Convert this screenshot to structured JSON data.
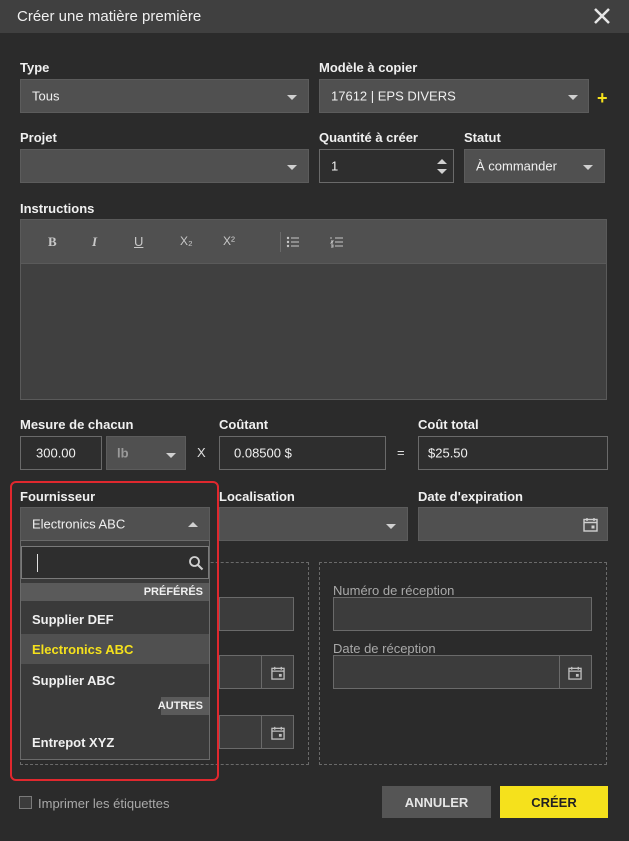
{
  "dialog": {
    "title": "Créer une matière première"
  },
  "type": {
    "label": "Type",
    "value": "Tous"
  },
  "model": {
    "label": "Modèle à copier",
    "value": "17612 | EPS DIVERS",
    "add_icon": "plus-icon"
  },
  "project": {
    "label": "Projet",
    "value": ""
  },
  "quantity": {
    "label": "Quantité à créer",
    "value": "1"
  },
  "status": {
    "label": "Statut",
    "value": "À commander"
  },
  "instructions": {
    "label": "Instructions",
    "toolbar": {
      "bold": "B",
      "italic": "I",
      "underline": "U",
      "subscript": "X₂",
      "superscript": "X²"
    }
  },
  "measure": {
    "label": "Mesure de chacun",
    "value": "300.00",
    "unit": "lb"
  },
  "times_symbol": "X",
  "cost": {
    "label": "Coûtant",
    "value": "0.08500 $"
  },
  "equals_symbol": "=",
  "total": {
    "label": "Coût total",
    "value": "$25.50"
  },
  "supplier": {
    "label": "Fournisseur",
    "value": "Electronics ABC",
    "search_value": "",
    "groups": [
      {
        "name": "PRÉFÉRÉS",
        "items": [
          "Supplier DEF",
          "Electronics ABC",
          "Supplier ABC"
        ]
      },
      {
        "name": "AUTRES",
        "items": [
          "Entrepot XYZ"
        ]
      }
    ],
    "selected": "Electronics ABC"
  },
  "location": {
    "label": "Localisation",
    "value": ""
  },
  "expiration": {
    "label": "Date d'expiration",
    "value": ""
  },
  "reception": {
    "number_label": "Numéro de réception",
    "number_value": "",
    "date_label": "Date de réception",
    "date_value": ""
  },
  "print_labels": {
    "label": "Imprimer les étiquettes",
    "checked": false
  },
  "buttons": {
    "cancel": "ANNULER",
    "create": "CRÉER"
  },
  "colors": {
    "accent": "#f5e11c",
    "highlight": "#e0282e",
    "background": "#2b2b2b"
  }
}
